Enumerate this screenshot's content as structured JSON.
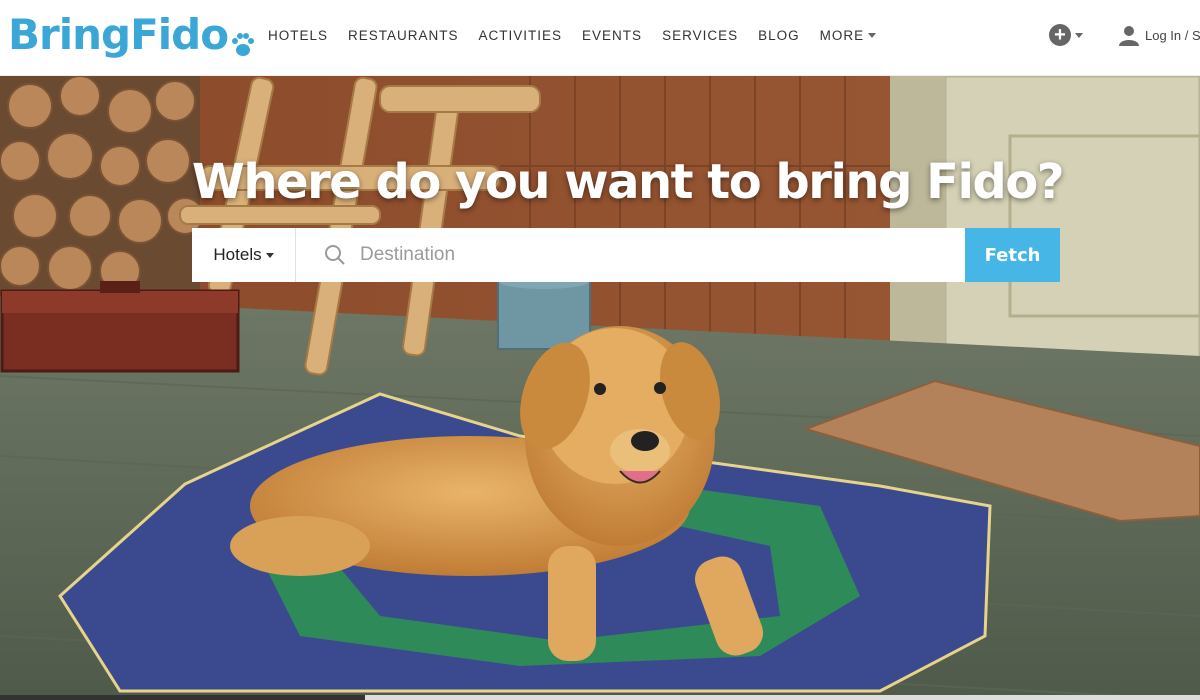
{
  "header": {
    "logo_text": "BringFido",
    "logo_color": "#3aa7d6",
    "nav": [
      {
        "label": "HOTELS"
      },
      {
        "label": "RESTAURANTS"
      },
      {
        "label": "ACTIVITIES"
      },
      {
        "label": "EVENTS"
      },
      {
        "label": "SERVICES"
      },
      {
        "label": "BLOG"
      },
      {
        "label": "MORE"
      }
    ],
    "add_icon": "plus-circle-icon",
    "login_label": "Log In / S"
  },
  "hero": {
    "headline": "Where do you want to bring Fido?",
    "search": {
      "category": "Hotels",
      "placeholder": "Destination",
      "button_label": "Fetch",
      "button_color": "#45b6e6"
    }
  }
}
